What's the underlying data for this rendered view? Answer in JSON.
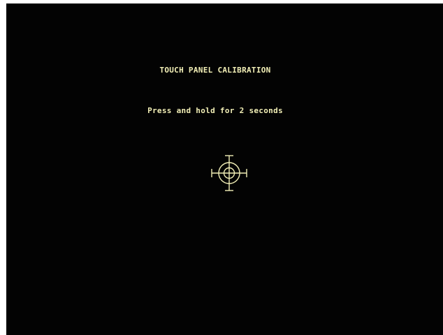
{
  "screen": {
    "title": "TOUCH PANEL CALIBRATION",
    "instruction": "Press and hold for 2 seconds"
  },
  "colors": {
    "background": "#030303",
    "foreground": "#f2efb6",
    "outer": "#ffffff"
  },
  "target": {
    "icon": "crosshair-target-icon"
  }
}
